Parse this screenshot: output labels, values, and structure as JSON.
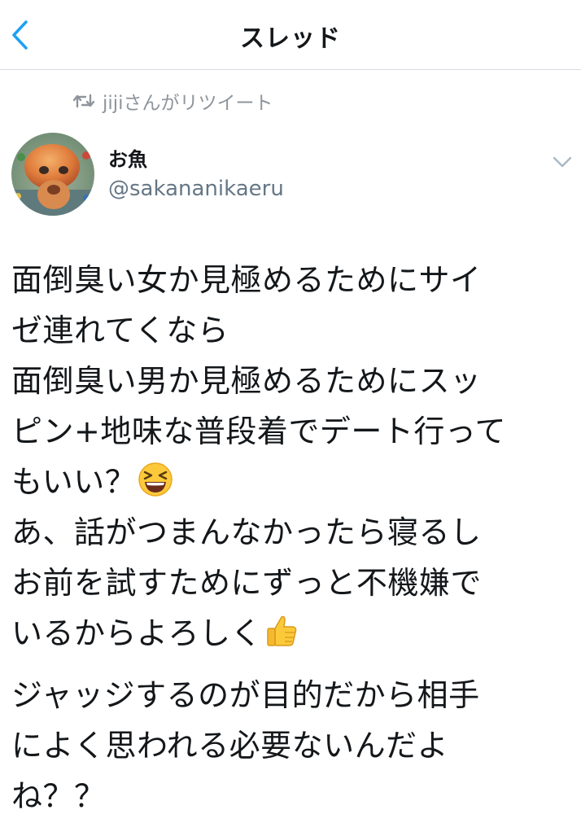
{
  "nav": {
    "title": "スレッド",
    "back_icon": "chevron-left-icon"
  },
  "retweet": {
    "icon": "retweet-icon",
    "text": "jijiさんがリツイート"
  },
  "author": {
    "name": "お魚",
    "handle": "@sakananikaeru",
    "avatar_icon": "goldfish-avatar"
  },
  "menu_icon": "chevron-down-icon",
  "tweet": {
    "lines_p1": [
      "面倒臭い女か見極めるためにサイ",
      "ゼ連れてくなら",
      "面倒臭い男か見極めるためにスッ",
      "ピン+地味な普段着でデート行って",
      "もいい？",
      "あ、話がつまんなかったら寝るし",
      "お前を試すためにずっと不機嫌で",
      "いるからよろしく"
    ],
    "lines_p2": [
      "ジャッジするのが目的だから相手",
      "によく思われる必要ないんだよ",
      "ね？？"
    ],
    "emoji_laugh": "grinning-squinting-face-emoji",
    "emoji_thumbs": "thumbs-up-emoji"
  },
  "colors": {
    "accent": "#1da1f2",
    "secondary_text": "#657786",
    "divider": "#d8dde2"
  }
}
